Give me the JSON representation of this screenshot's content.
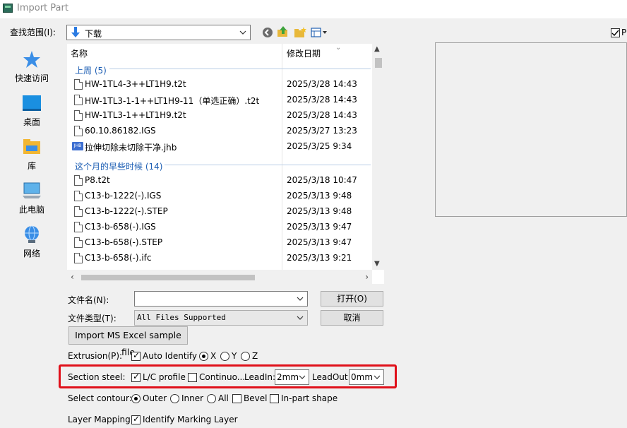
{
  "window": {
    "title": "Import Part"
  },
  "lookin": {
    "label": "查找范围(I):",
    "value": "下载"
  },
  "toolbar": {
    "icons": [
      "back-icon",
      "up-folder-icon",
      "new-folder-icon",
      "view-menu-icon"
    ]
  },
  "places": [
    {
      "label": "快速访问",
      "icon": "star-icon"
    },
    {
      "label": "桌面",
      "icon": "desktop-icon"
    },
    {
      "label": "库",
      "icon": "library-icon"
    },
    {
      "label": "此电脑",
      "icon": "computer-icon"
    },
    {
      "label": "网络",
      "icon": "network-icon"
    }
  ],
  "filelist": {
    "col_name": "名称",
    "col_date": "修改日期",
    "group1": "上周 (5)",
    "group2": "这个月的早些时候 (14)",
    "rows": [
      {
        "name": "HW-1TL4-3++LT1H9.t2t",
        "date": "2025/3/28 14:43",
        "icon": "file-icon"
      },
      {
        "name": "HW-1TL3-1-1++LT1H9-11（单选正确）.t2t",
        "date": "2025/3/28 14:43",
        "icon": "file-icon"
      },
      {
        "name": "HW-1TL3-1++LT1H9.t2t",
        "date": "2025/3/28 14:43",
        "icon": "file-icon"
      },
      {
        "name": "60.10.86182.IGS",
        "date": "2025/3/27 13:23",
        "icon": "file-icon"
      },
      {
        "name": "拉伸切除未切除干净.jhb",
        "date": "2025/3/25 9:34",
        "icon": "jhb-file-icon",
        "icon_text": "JHB"
      },
      {
        "name": "P8.t2t",
        "date": "2025/3/18 10:47",
        "icon": "file-icon"
      },
      {
        "name": "C13-b-1222(-).IGS",
        "date": "2025/3/13 9:48",
        "icon": "file-icon"
      },
      {
        "name": "C13-b-1222(-).STEP",
        "date": "2025/3/13 9:48",
        "icon": "file-icon"
      },
      {
        "name": "C13-b-658(-).IGS",
        "date": "2025/3/13 9:47",
        "icon": "file-icon"
      },
      {
        "name": "C13-b-658(-).STEP",
        "date": "2025/3/13 9:47",
        "icon": "file-icon"
      },
      {
        "name": "C13-b-658(-).ifc",
        "date": "2025/3/13 9:21",
        "icon": "file-icon"
      }
    ]
  },
  "preview": {
    "checkbox_label": "P",
    "checked": true
  },
  "filename": {
    "label": "文件名(N):",
    "value": ""
  },
  "filetype": {
    "label": "文件类型(T):",
    "value": "All Files Supported"
  },
  "buttons": {
    "open": "打开(O)",
    "cancel": "取消",
    "import_excel": "Import MS Excel sample file"
  },
  "extrusion": {
    "label": "Extrusion(P):",
    "auto_identify": "Auto Identify",
    "x": "X",
    "y": "Y",
    "z": "Z",
    "selected": "X"
  },
  "section_steel": {
    "label": "Section steel:",
    "lc_profile": "L/C profile",
    "continuous": "Continuo...",
    "leadin_label": "LeadIn:",
    "leadin_value": "2mm",
    "leadout_label": "LeadOut:",
    "leadout_value": "0mm"
  },
  "contour": {
    "label": "Select contour:",
    "outer": "Outer",
    "inner": "Inner",
    "all": "All",
    "bevel": "Bevel",
    "inpart": "In-part shape",
    "selected": "Outer"
  },
  "layer": {
    "label": "Layer Mapping",
    "identify": "Identify Marking Layer"
  },
  "colors": {
    "highlight": "#e0101a",
    "group_text": "#1e5fb4"
  }
}
